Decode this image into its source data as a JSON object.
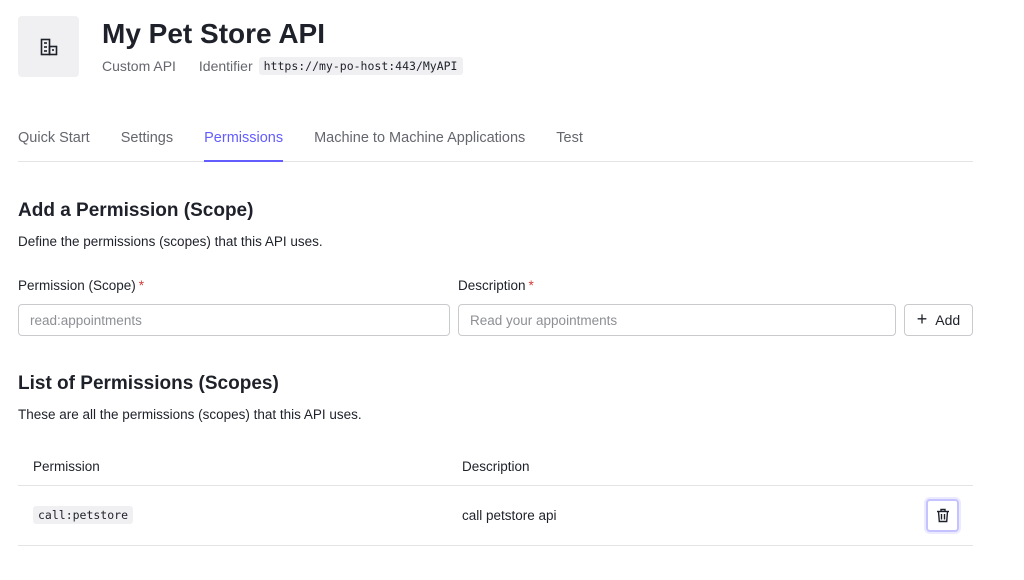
{
  "header": {
    "icon": "building-icon",
    "title": "My Pet Store API",
    "type": "Custom API",
    "identifier_label": "Identifier",
    "identifier_value": "https://my-po-host:443/MyAPI"
  },
  "tabs": [
    {
      "label": "Quick Start",
      "active": false
    },
    {
      "label": "Settings",
      "active": false
    },
    {
      "label": "Permissions",
      "active": true
    },
    {
      "label": "Machine to Machine Applications",
      "active": false
    },
    {
      "label": "Test",
      "active": false
    }
  ],
  "add_section": {
    "title": "Add a Permission (Scope)",
    "description": "Define the permissions (scopes) that this API uses.",
    "permission_label": "Permission (Scope)",
    "permission_placeholder": "read:appointments",
    "description_label": "Description",
    "description_placeholder": "Read your appointments",
    "required_marker": "*",
    "add_button": "Add"
  },
  "list_section": {
    "title": "List of Permissions (Scopes)",
    "description": "These are all the permissions (scopes) that this API uses.",
    "columns": [
      "Permission",
      "Description"
    ],
    "rows": [
      {
        "permission": "call:petstore",
        "description": "call petstore api"
      }
    ]
  },
  "colors": {
    "accent": "#635dff",
    "required": "#d03c38"
  }
}
